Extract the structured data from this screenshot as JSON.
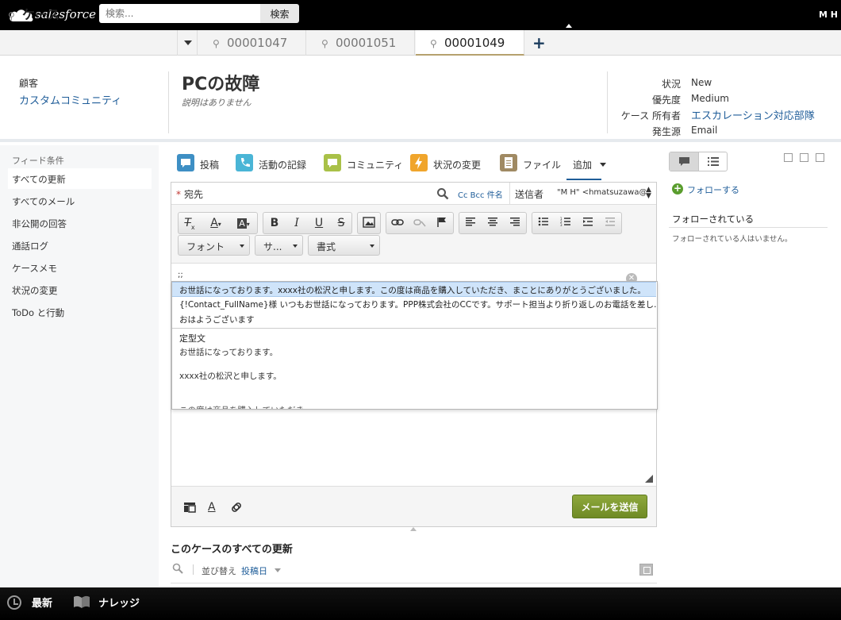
{
  "app": {
    "logo_text": "salesforce",
    "user_initials": "M H"
  },
  "search": {
    "placeholder": "検索...",
    "button_label": "検索"
  },
  "tabs": {
    "main_label": "ケース",
    "subtabs": [
      {
        "label": "00001047",
        "active": false
      },
      {
        "label": "00001051",
        "active": false
      },
      {
        "label": "00001049",
        "active": true
      }
    ],
    "add_label": "+"
  },
  "highlights": {
    "customer_label": "顧客",
    "customer_value": "カスタムコミュニティ",
    "title": "PCの故障",
    "description": "説明はありません",
    "fields": [
      {
        "label": "状況",
        "value": "New",
        "link": false
      },
      {
        "label": "優先度",
        "value": "Medium",
        "link": false
      },
      {
        "label": "ケース 所有者",
        "value": "エスカレーション対応部隊",
        "link": true
      },
      {
        "label": "発生源",
        "value": "Email",
        "link": false
      }
    ]
  },
  "sidebar": {
    "heading": "フィード条件",
    "items": [
      {
        "label": "すべての更新",
        "active": true
      },
      {
        "label": "すべてのメール",
        "active": false
      },
      {
        "label": "非公開の回答",
        "active": false
      },
      {
        "label": "通話ログ",
        "active": false
      },
      {
        "label": "ケースメモ",
        "active": false
      },
      {
        "label": "状況の変更",
        "active": false
      },
      {
        "label": "ToDo と行動",
        "active": false
      }
    ]
  },
  "publisher": {
    "actions": [
      {
        "label": "投稿",
        "icon": "post-icon",
        "color": "#3e8fc4"
      },
      {
        "label": "活動の記録",
        "icon": "phone-icon",
        "color": "#4ab5d6"
      },
      {
        "label": "コミュニティ",
        "icon": "community-icon",
        "color": "#a9c148"
      },
      {
        "label": "状況の変更",
        "icon": "lightning-icon",
        "color": "#f0a52c"
      },
      {
        "label": "ファイル",
        "icon": "file-icon",
        "color": "#a08a63"
      }
    ],
    "more_label": "追加"
  },
  "email": {
    "to_label": "宛先",
    "required_mark": "*",
    "cc_bcc_label": "Cc Bcc 件名",
    "from_label": "送信者",
    "from_value": "\"M H\" <hmatsuzawa@",
    "font_dropdown": "フォント",
    "size_dropdown": "サ...",
    "format_dropdown": "書式",
    "editor_text": ";;",
    "send_label": "メールを送信"
  },
  "quicktext": {
    "options": [
      "お世話になっております。xxxx社の松沢と申します。この度は商品を購入していただき、まことにありがとうございました。",
      "{!Contact_FullName}様 いつもお世話になっております。PPP株式会社のCCです。サポート担当より折り返しのお電話を差し…",
      "おはようございます"
    ],
    "preview_title": "定型文",
    "preview_lines": [
      "お世話になっております。",
      "xxxx社の松沢と申します。"
    ],
    "preview_clipped": "この度は商品を購入していただき"
  },
  "feed": {
    "title": "このケースのすべての更新",
    "sort_label": "並び替え",
    "sort_value": "投稿日"
  },
  "right_panel": {
    "follow_label": "フォローする",
    "followers_heading": "フォローされている",
    "followers_empty": "フォローされている人はいません。"
  },
  "bottom_bar": {
    "recent_label": "最新",
    "knowledge_label": "ナレッジ"
  },
  "colors": {
    "link": "#1f5d99",
    "send_button": "#7a9630",
    "tab_active_underline": "#b5a16e"
  }
}
